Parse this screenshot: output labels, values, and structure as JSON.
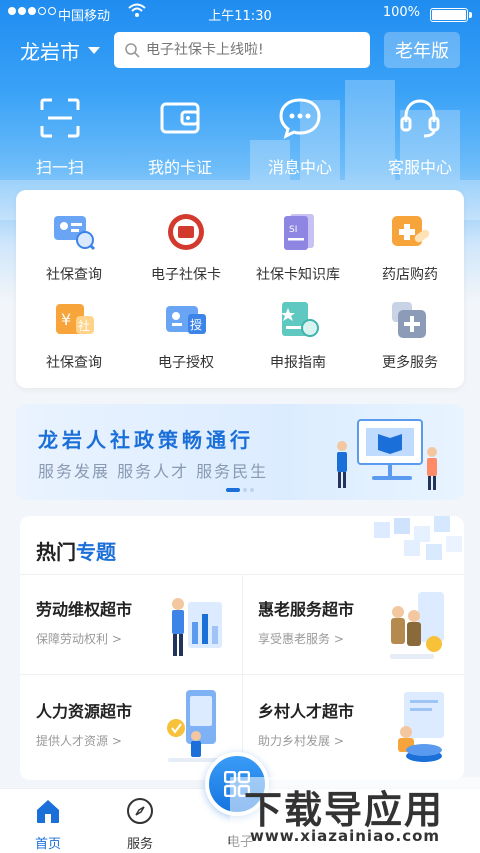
{
  "status_bar": {
    "carrier": "中国移动",
    "time": "上午11:30",
    "battery": "100%"
  },
  "top_bar": {
    "city": "龙岩市",
    "search_placeholder": "电子社保卡上线啦!",
    "elder_mode": "老年版"
  },
  "quick_actions": [
    {
      "label": "扫一扫",
      "icon": "scan-icon"
    },
    {
      "label": "我的卡证",
      "icon": "wallet-icon"
    },
    {
      "label": "消息中心",
      "icon": "message-icon"
    },
    {
      "label": "客服中心",
      "icon": "headset-icon"
    }
  ],
  "services": [
    {
      "label": "社保查询",
      "icon": "id-card-search-icon"
    },
    {
      "label": "电子社保卡",
      "icon": "seal-icon"
    },
    {
      "label": "社保卡知识库",
      "icon": "knowledge-icon"
    },
    {
      "label": "药店购药",
      "icon": "medicine-icon"
    },
    {
      "label": "社保查询",
      "icon": "yuan-social-icon"
    },
    {
      "label": "电子授权",
      "icon": "authorize-icon"
    },
    {
      "label": "申报指南",
      "icon": "guide-icon"
    },
    {
      "label": "更多服务",
      "icon": "more-icon"
    }
  ],
  "banner": {
    "title": "龙岩人社政策畅通行",
    "subtitle": "服务发展 服务人才 服务民生"
  },
  "hot_topics": {
    "title_black": "热门",
    "title_blue": "专题",
    "items": [
      {
        "name": "劳动维权超市",
        "sub": "保障劳动权利 >"
      },
      {
        "name": "惠老服务超市",
        "sub": "享受惠老服务 >"
      },
      {
        "name": "人力资源超市",
        "sub": "提供人才资源 >"
      },
      {
        "name": "乡村人才超市",
        "sub": "助力乡村发展 >"
      }
    ]
  },
  "tabbar": {
    "home": "首页",
    "service": "服务",
    "center": "电子"
  },
  "watermark": {
    "line1": "下载导应用",
    "line2": "www.xiazainiao.com"
  },
  "colors": {
    "primary": "#1a6fd8",
    "header": "#1f8cf0",
    "bg": "#f2f5f9"
  }
}
